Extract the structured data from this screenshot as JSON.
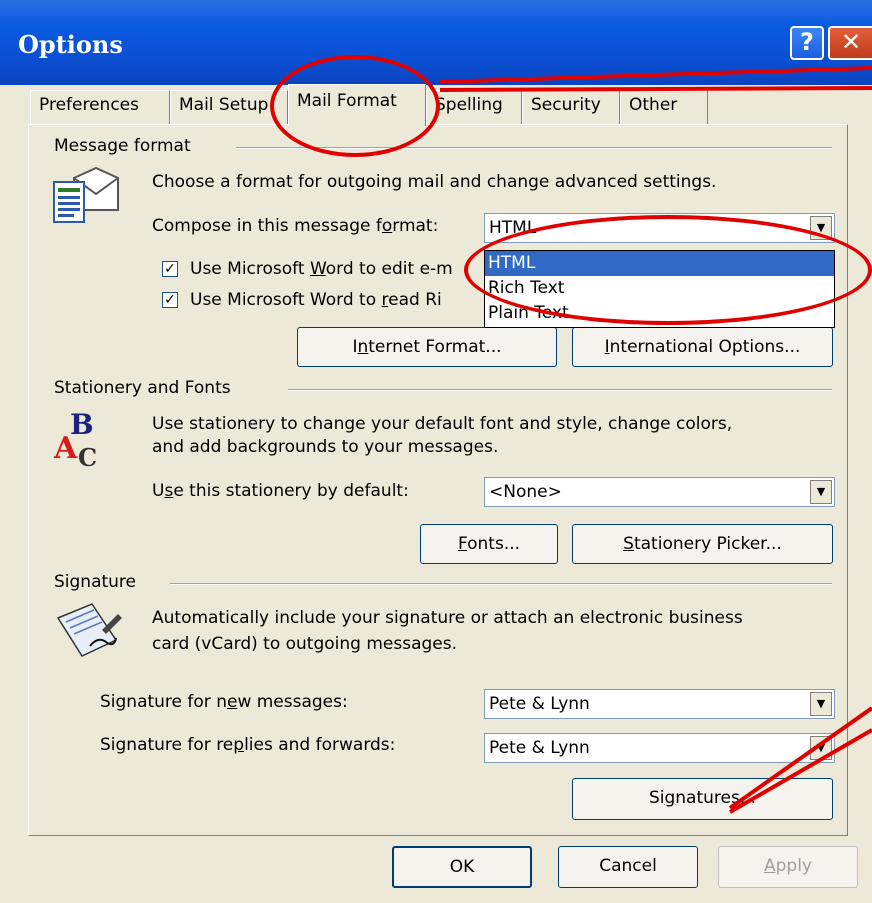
{
  "window": {
    "title": "Options",
    "help_label": "?",
    "close_label": "✕"
  },
  "tabs": [
    {
      "label": "Preferences"
    },
    {
      "label": "Mail Setup"
    },
    {
      "label": "Mail Format"
    },
    {
      "label": "Spelling"
    },
    {
      "label": "Security"
    },
    {
      "label": "Other"
    }
  ],
  "message_format": {
    "heading": "Message format",
    "description": "Choose a format for outgoing mail and change advanced settings.",
    "compose_label_pre": "Compose in this message f",
    "compose_label_key": "o",
    "compose_label_post": "rmat:",
    "compose_value": "HTML",
    "word_edit_pre": "Use Microsoft ",
    "word_edit_key": "W",
    "word_edit_post": "ord to edit e-m",
    "word_read_pre": "Use Microsoft Word to ",
    "word_read_key": "r",
    "word_read_post": "ead Ri",
    "options": [
      "HTML",
      "Rich Text",
      "Plain Text"
    ],
    "internet_format_pre": "I",
    "internet_format_key": "n",
    "internet_format_post": "ternet Format...",
    "international_pre": "",
    "international_key": "I",
    "international_post": "nternational Options..."
  },
  "stationery": {
    "heading": "Stationery and Fonts",
    "description_line1": "Use stationery to change your default font and style, change colors,",
    "description_line2": "and add backgrounds to your messages.",
    "default_label_pre": "U",
    "default_label_key": "s",
    "default_label_post": "e this stationery by default:",
    "default_value": "<None>",
    "fonts_key": "F",
    "fonts_post": "onts...",
    "picker_key": "S",
    "picker_post": "tationery Picker..."
  },
  "signature": {
    "heading": "Signature",
    "description_line1": "Automatically include your signature or attach an electronic business",
    "description_line2": "card (vCard) to outgoing messages.",
    "new_label_pre": "Signature for n",
    "new_label_key": "e",
    "new_label_post": "w messages:",
    "new_value": "Pete & Lynn",
    "reply_label_pre": "Signature for re",
    "reply_label_key": "p",
    "reply_label_post": "lies and forwards:",
    "reply_value": "Pete & Lynn",
    "signatures_pre": "Si",
    "signatures_key": "g",
    "signatures_post": "natures..."
  },
  "footer": {
    "ok": "OK",
    "cancel": "Cancel",
    "apply_key": "A",
    "apply_post": "pply"
  },
  "colors": {
    "annotation": "#e00000",
    "selection": "#316ac5",
    "titlebar": "#0a5ae0"
  },
  "icons": [
    "help-icon",
    "close-icon",
    "envelope-doc-icon",
    "stationery-abc-icon",
    "signature-pen-icon",
    "dropdown-arrow-icon",
    "checkmark-icon"
  ]
}
